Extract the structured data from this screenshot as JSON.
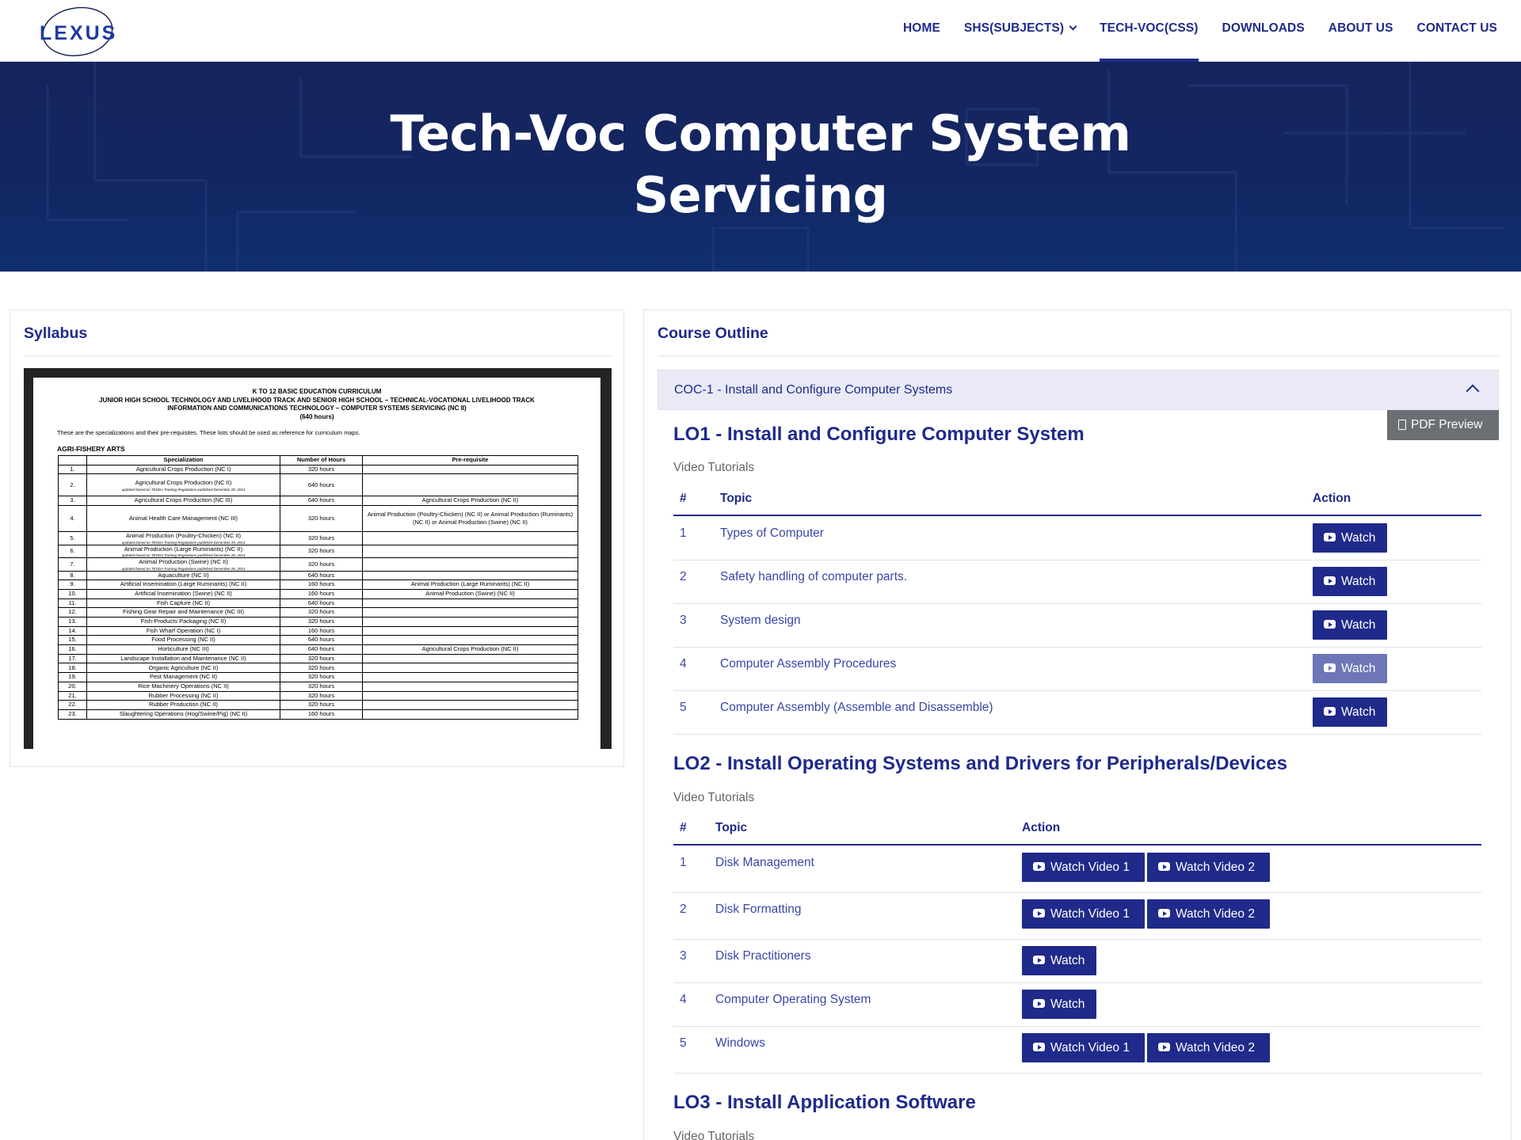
{
  "brand": {
    "logo_text": "LEXUS"
  },
  "nav": {
    "items": [
      "HOME",
      "SHS(SUBJECTS)",
      "TECH-VOC(CSS)",
      "DOWNLOADS",
      "ABOUT US",
      "CONTACT US"
    ],
    "active": "TECH-VOC(CSS)"
  },
  "hero": {
    "title_line1": "Tech-Voc Computer System",
    "title_line2": "Servicing"
  },
  "syllabus": {
    "title": "Syllabus",
    "doc": {
      "head1": "K TO 12 BASIC EDUCATION CURRICULUM",
      "head2": "JUNIOR HIGH SCHOOL TECHNOLOGY AND LIVELIHOOD TRACK AND SENIOR HIGH SCHOOL – TECHNICAL-VOCATIONAL LIVELIHOOD TRACK",
      "head3": "INFORMATION AND COMMUNICATIONS TECHNOLOGY – COMPUTER SYSTEMS SERVICING (NC II)",
      "head4": "(640 hours)",
      "note": "These are the specializations and their pre-requisites.  These lists should be used as reference for curriculum maps.",
      "section": "AGRI-FISHERY ARTS",
      "columns": [
        "Specialization",
        "Number of Hours",
        "Pre-requisite"
      ],
      "rows": [
        [
          "1.",
          "Agricultural Crops Production (NC I)",
          "320 hours",
          ""
        ],
        [
          "2.",
          "Agricultural Crops Production (NC II)",
          "640 hours",
          ""
        ],
        [
          "3.",
          "Agricultural Crops Production (NC III)",
          "640 hours",
          "Agricultural Crops Production (NC II)"
        ],
        [
          "4.",
          "Animal Health Care Management (NC III)",
          "320 hours",
          "Animal Production (Poultry-Chicken) (NC II) or Animal Production (Ruminants) (NC II) or Animal Production (Swine) (NC II)"
        ],
        [
          "5.",
          "Animal Production (Poultry-Chicken) (NC II)",
          "320 hours",
          ""
        ],
        [
          "6.",
          "Animal Production (Large Ruminants) (NC II)",
          "320 hours",
          ""
        ],
        [
          "7.",
          "Animal Production (Swine) (NC II)",
          "320 hours",
          ""
        ],
        [
          "8.",
          "Aquaculture (NC II)",
          "640 hours",
          ""
        ],
        [
          "9.",
          "Artificial Insemination (Large Ruminants) (NC II)",
          "160 hours",
          "Animal Production (Large Ruminants) (NC II)"
        ],
        [
          "10.",
          "Artificial Insemination (Swine) (NC II)",
          "160 hours",
          "Animal Production (Swine) (NC II)"
        ],
        [
          "11.",
          "Fish Capture (NC II)",
          "640 hours",
          ""
        ],
        [
          "12.",
          "Fishing Gear Repair and Maintenance (NC III)",
          "320 hours",
          ""
        ],
        [
          "13.",
          "Fish-Products Packaging (NC II)",
          "320 hours",
          ""
        ],
        [
          "14.",
          "Fish Wharf Operation (NC I)",
          "160 hours",
          ""
        ],
        [
          "15.",
          "Food Processing (NC II)",
          "640 hours",
          ""
        ],
        [
          "16.",
          "Horticulture (NC III)",
          "640 hours",
          "Agricultural Crops Production (NC II)"
        ],
        [
          "17.",
          "Landscape Installation and Maintenance (NC II)",
          "320 hours",
          ""
        ],
        [
          "18.",
          "Organic Agriculture (NC II)",
          "320 hours",
          ""
        ],
        [
          "19.",
          "Pest Management (NC II)",
          "320 hours",
          ""
        ],
        [
          "20.",
          "Rice Machinery Operations (NC II)",
          "320 hours",
          ""
        ],
        [
          "21.",
          "Rubber Processing (NC II)",
          "320 hours",
          ""
        ],
        [
          "22.",
          "Rubber Production (NC II)",
          "320 hours",
          ""
        ],
        [
          "23.",
          "Slaughtering Operations (Hog/Swine/Pig) (NC II)",
          "160 hours",
          ""
        ]
      ],
      "update_note": "updated based on TESDA Training Regulations published December 28, 2013"
    }
  },
  "outline": {
    "title": "Course Outline",
    "accordion_label": "COC-1 - Install and Configure Computer Systems",
    "pdf_label": "PDF Preview",
    "video_tutorials_label": "Video Tutorials",
    "headers": {
      "num": "#",
      "topic": "Topic",
      "action": "Action"
    },
    "lo1": {
      "title": "LO1 - Install and Configure Computer System",
      "rows": [
        {
          "num": "1",
          "topic": "Types of Computer",
          "buttons": [
            "Watch"
          ]
        },
        {
          "num": "2",
          "topic": "Safety handling of computer parts.",
          "buttons": [
            "Watch"
          ]
        },
        {
          "num": "3",
          "topic": "System design",
          "buttons": [
            "Watch"
          ]
        },
        {
          "num": "4",
          "topic": "Computer Assembly Procedures",
          "buttons": [
            "Watch"
          ]
        },
        {
          "num": "5",
          "topic": "Computer Assembly (Assemble and Disassemble)",
          "buttons": [
            "Watch"
          ]
        }
      ]
    },
    "lo2": {
      "title": "LO2 - Install Operating Systems and Drivers for Peripherals/Devices",
      "rows": [
        {
          "num": "1",
          "topic": "Disk Management",
          "buttons": [
            "Watch Video 1",
            "Watch Video 2"
          ]
        },
        {
          "num": "2",
          "topic": "Disk Formatting",
          "buttons": [
            "Watch Video 1",
            "Watch Video 2"
          ]
        },
        {
          "num": "3",
          "topic": "Disk Practitioners",
          "buttons": [
            "Watch"
          ]
        },
        {
          "num": "4",
          "topic": "Computer Operating System",
          "buttons": [
            "Watch"
          ]
        },
        {
          "num": "5",
          "topic": "Windows",
          "buttons": [
            "Watch Video 1",
            "Watch Video 2"
          ]
        }
      ]
    },
    "lo3": {
      "title": "LO3 - Install Application Software"
    }
  },
  "colors": {
    "primary": "#1f2a8a",
    "hero_bg": "#16245c",
    "pdf_btn": "#6a6f74",
    "accordion_bg": "#e9eaf6"
  }
}
